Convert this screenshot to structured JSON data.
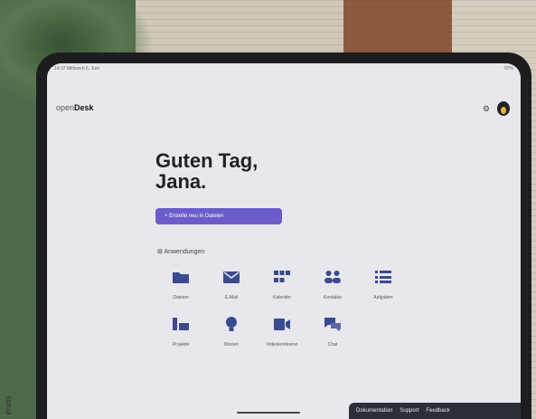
{
  "photo": {
    "credit": "endis"
  },
  "status": {
    "left": "14:37  Mittwoch 6. Juni",
    "right": "97%"
  },
  "app": {
    "brand_prefix": "open",
    "brand_suffix": "Desk"
  },
  "greeting": "Guten Tag,\nJana.",
  "cta_label": "+ Erstelle neu in Dateien",
  "section_label": "Anwendungen",
  "apps": [
    {
      "label": "Dateien",
      "icon": "folder-icon"
    },
    {
      "label": "E-Mail",
      "icon": "mail-icon"
    },
    {
      "label": "Kalender",
      "icon": "grid-icon"
    },
    {
      "label": "Kontakte",
      "icon": "contacts-icon"
    },
    {
      "label": "Aufgaben",
      "icon": "list-icon"
    },
    {
      "label": "Projekte",
      "icon": "board-icon"
    },
    {
      "label": "Wissen",
      "icon": "bulb-icon"
    },
    {
      "label": "Videokonferenz",
      "icon": "video-icon"
    },
    {
      "label": "Chat",
      "icon": "chat-icon"
    }
  ],
  "bottom": [
    "Dokumentation",
    "Support",
    "Feedback"
  ],
  "colors": {
    "accent": "#6b5cc9",
    "icon": "#3b4a8f"
  }
}
